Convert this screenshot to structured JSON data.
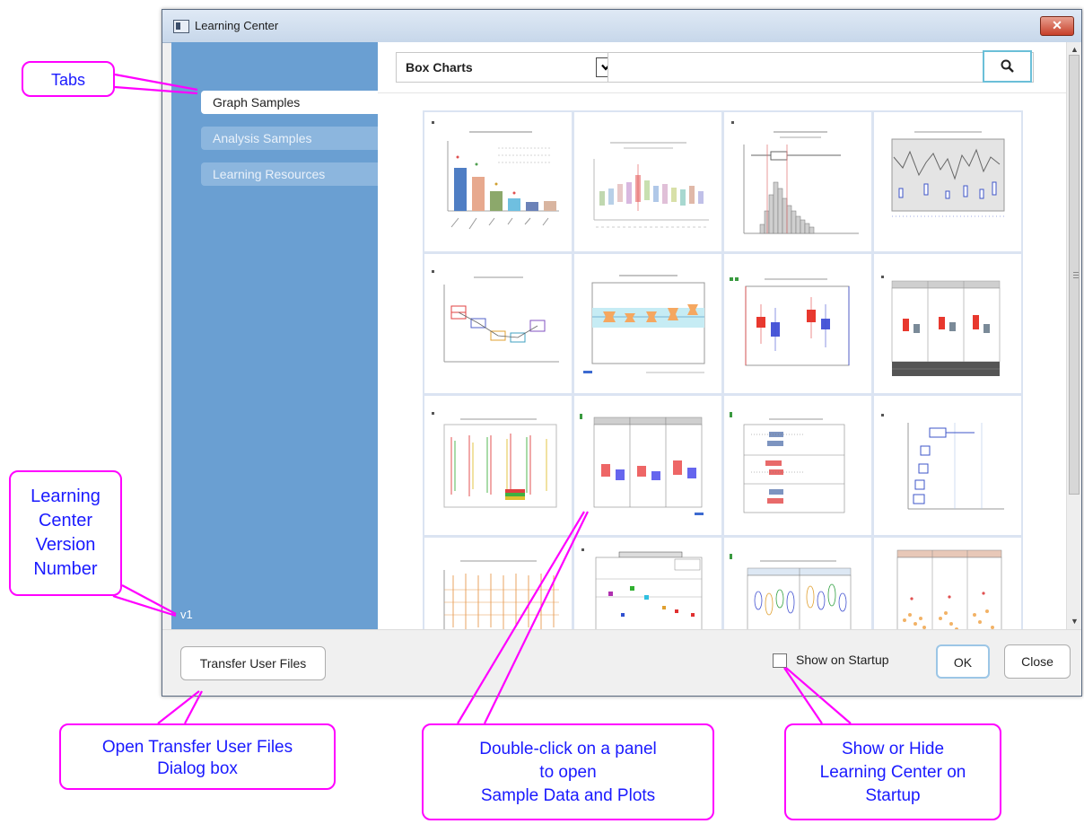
{
  "window": {
    "title": "Learning Center",
    "close_glyph": "✕"
  },
  "sidebar": {
    "tabs": [
      {
        "label": "Graph Samples",
        "active": true
      },
      {
        "label": "Analysis Samples",
        "active": false
      },
      {
        "label": "Learning Resources",
        "active": false
      }
    ],
    "version": "v1"
  },
  "toolbar": {
    "category_value": "Box Charts",
    "search_value": "",
    "search_icon": "search-icon",
    "dropdown_icon": "chevron-down-icon"
  },
  "footer": {
    "transfer_label": "Transfer User Files",
    "show_on_startup_label": "Show on Startup",
    "show_on_startup_checked": false,
    "ok_label": "OK",
    "close_label": "Close"
  },
  "annotations": {
    "tabs": "Tabs",
    "version": [
      "Learning",
      "Center",
      "Version",
      "Number"
    ],
    "transfer": [
      "Open Transfer User Files",
      "Dialog box"
    ],
    "double_click": [
      "Double-click on a panel",
      "to open",
      "Sample Data and Plots"
    ],
    "show_hide": [
      "Show or Hide",
      "Learning Center on",
      "Startup"
    ]
  },
  "colors": {
    "sidebar": "#6a9fd2",
    "annotation_border": "#ff00ff",
    "annotation_text": "#1a1aff",
    "grid_border": "#dbe4f2"
  }
}
